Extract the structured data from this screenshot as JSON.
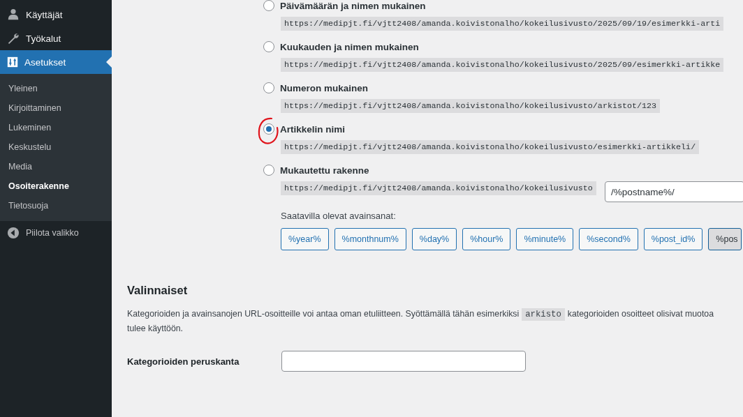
{
  "sidebar": {
    "items": [
      {
        "label": "Käyttäjät",
        "selected": false
      },
      {
        "label": "Työkalut",
        "selected": false
      },
      {
        "label": "Asetukset",
        "selected": true
      }
    ],
    "submenu": [
      {
        "label": "Yleinen",
        "selected": false
      },
      {
        "label": "Kirjoittaminen",
        "selected": false
      },
      {
        "label": "Lukeminen",
        "selected": false
      },
      {
        "label": "Keskustelu",
        "selected": false
      },
      {
        "label": "Media",
        "selected": false
      },
      {
        "label": "Osoiterakenne",
        "selected": true
      },
      {
        "label": "Tietosuoja",
        "selected": false
      }
    ],
    "collapse": {
      "label": "Piilota valikko"
    }
  },
  "permalink_options": [
    {
      "kind": "preset",
      "label": "Päivämäärän ja nimen mukainen",
      "url": "https://medipjt.fi/vjtt2408/amanda.koivistonalho/kokeilusivusto/2025/09/19/esimerkki-arti",
      "selected": false
    },
    {
      "kind": "preset",
      "label": "Kuukauden ja nimen mukainen",
      "url": "https://medipjt.fi/vjtt2408/amanda.koivistonalho/kokeilusivusto/2025/09/esimerkki-artikke",
      "selected": false
    },
    {
      "kind": "preset",
      "label": "Numeron mukainen",
      "url": "https://medipjt.fi/vjtt2408/amanda.koivistonalho/kokeilusivusto/arkistot/123",
      "selected": false
    },
    {
      "kind": "preset",
      "label": "Artikkelin nimi",
      "url": "https://medipjt.fi/vjtt2408/amanda.koivistonalho/kokeilusivusto/esimerkki-artikkeli/",
      "selected": true
    },
    {
      "kind": "custom",
      "label": "Mukautettu rakenne",
      "url": "https://medipjt.fi/vjtt2408/amanda.koivistonalho/kokeilusivusto",
      "value": "/%postname%/",
      "selected": false
    }
  ],
  "tags_label": "Saatavilla olevat avainsanat:",
  "tags": [
    {
      "label": "%year%",
      "active": false
    },
    {
      "label": "%monthnum%",
      "active": false
    },
    {
      "label": "%day%",
      "active": false
    },
    {
      "label": "%hour%",
      "active": false
    },
    {
      "label": "%minute%",
      "active": false
    },
    {
      "label": "%second%",
      "active": false
    },
    {
      "label": "%post_id%",
      "active": false
    },
    {
      "label": "%pos",
      "active": true
    }
  ],
  "optional": {
    "heading": "Valinnaiset",
    "description": {
      "before": "Kategorioiden ja avainsanojen URL-osoitteille voi antaa oman etuliitteen. Syöttämällä tähän esimerkiksi",
      "code": "arkisto",
      "after": "kategorioiden osoitteet olisivat muotoa",
      "line_2": "tulee käyttöön."
    },
    "fields": [
      {
        "label": "Kategorioiden peruskanta"
      }
    ]
  }
}
